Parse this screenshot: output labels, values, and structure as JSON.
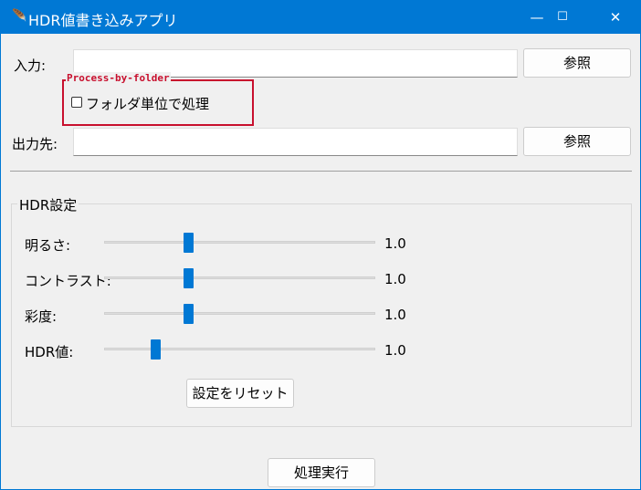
{
  "window": {
    "title": "HDR値書き込みアプリ",
    "icon": "feather-icon",
    "minimize": "—",
    "maximize": "☐",
    "close": "✕"
  },
  "input": {
    "label": "入力:",
    "value": "",
    "browse": "参照"
  },
  "folder_option": {
    "frame_title": "Process-by-folder",
    "checkbox_label": "フォルダ単位で処理",
    "checked": false
  },
  "output": {
    "label": "出力先:",
    "value": "",
    "browse": "参照"
  },
  "hdr": {
    "group_title": "HDR設定",
    "sliders": [
      {
        "label": "明るさ:",
        "value": "1.0",
        "position": 0.31
      },
      {
        "label": "コントラスト:",
        "value": "1.0",
        "position": 0.31
      },
      {
        "label": "彩度:",
        "value": "1.0",
        "position": 0.31
      },
      {
        "label": "HDR値:",
        "value": "1.0",
        "position": 0.19
      }
    ],
    "reset": "設定をリセット"
  },
  "run": "処理実行",
  "colors": {
    "accent": "#0078d4",
    "frame": "#c8102e"
  }
}
